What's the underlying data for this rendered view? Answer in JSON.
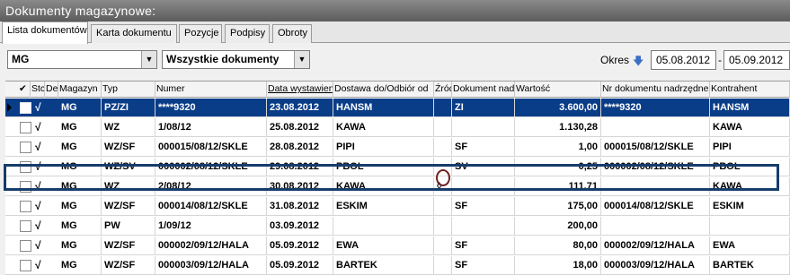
{
  "window": {
    "title": "Dokumenty magazynowe:"
  },
  "tabs": [
    {
      "label": "Lista dokumentów",
      "active": true
    },
    {
      "label": "Karta dokumentu",
      "active": false
    },
    {
      "label": "Pozycje",
      "active": false
    },
    {
      "label": "Podpisy",
      "active": false
    },
    {
      "label": "Obroty",
      "active": false
    }
  ],
  "filters": {
    "magazyn": "MG",
    "dokumenty": "Wszystkie dokumenty",
    "okres_label": "Okres",
    "date_from": "05.08.2012",
    "date_to": "05.09.2012",
    "date_separator": "-"
  },
  "columns": {
    "check": "✔",
    "status": "Stc",
    "de": "De",
    "magazyn": "Magazyn",
    "typ": "Typ",
    "numer": "Numer",
    "data": "Data wystawien",
    "dostawa": "Dostawa do/Odbiór od",
    "zrodlo": "Źródł",
    "dok_nadrz": "Dokument nadrz",
    "wartosc": "Wartość",
    "nr_dok_nadrz": "Nr dokumentu nadrzędne",
    "kontrahent": "Kontrahent"
  },
  "rows": [
    {
      "mark": "√",
      "magazyn": "MG",
      "typ": "PZ/ZI",
      "numer": "****9320",
      "data": "23.08.2012",
      "dostawa": "HANSM",
      "zrodlo": "",
      "dok_nadrz": "ZI",
      "wartosc": "3.600,00",
      "nr_dok_nadrz": "****9320",
      "kontrahent": "HANSM",
      "selected": true
    },
    {
      "mark": "√",
      "magazyn": "MG",
      "typ": "WZ",
      "numer": "1/08/12",
      "data": "25.08.2012",
      "dostawa": "KAWA",
      "zrodlo": "",
      "dok_nadrz": "",
      "wartosc": "1.130,28",
      "nr_dok_nadrz": "",
      "kontrahent": "KAWA",
      "selected": false
    },
    {
      "mark": "√",
      "magazyn": "MG",
      "typ": "WZ/SF",
      "numer": "000015/08/12/SKLE",
      "data": "28.08.2012",
      "dostawa": "PIPI",
      "zrodlo": "",
      "dok_nadrz": "SF",
      "wartosc": "1,00",
      "nr_dok_nadrz": "000015/08/12/SKLE",
      "kontrahent": "PIPI",
      "selected": false
    },
    {
      "mark": "√",
      "magazyn": "MG",
      "typ": "WZ/SV",
      "numer": "000002/08/12/SKLE",
      "data": "29.08.2012",
      "dostawa": "PBOL",
      "zrodlo": "",
      "dok_nadrz": "SV",
      "wartosc": "0,25",
      "nr_dok_nadrz": "000002/08/12/SKLE",
      "kontrahent": "PBOL",
      "selected": false
    },
    {
      "mark": "√",
      "magazyn": "MG",
      "typ": "WZ",
      "numer": "2/08/12",
      "data": "30.08.2012",
      "dostawa": "KAWA",
      "zrodlo": "◊",
      "dok_nadrz": "",
      "wartosc": "111,71",
      "nr_dok_nadrz": "",
      "kontrahent": "KAWA",
      "selected": false
    },
    {
      "mark": "√",
      "magazyn": "MG",
      "typ": "WZ/SF",
      "numer": "000014/08/12/SKLE",
      "data": "31.08.2012",
      "dostawa": "ESKIM",
      "zrodlo": "",
      "dok_nadrz": "SF",
      "wartosc": "175,00",
      "nr_dok_nadrz": "000014/08/12/SKLE",
      "kontrahent": "ESKIM",
      "selected": false
    },
    {
      "mark": "√",
      "magazyn": "MG",
      "typ": "PW",
      "numer": "1/09/12",
      "data": "03.09.2012",
      "dostawa": "",
      "zrodlo": "",
      "dok_nadrz": "",
      "wartosc": "200,00",
      "nr_dok_nadrz": "",
      "kontrahent": "",
      "selected": false
    },
    {
      "mark": "√",
      "magazyn": "MG",
      "typ": "WZ/SF",
      "numer": "000002/09/12/HALA",
      "data": "05.09.2012",
      "dostawa": "EWA",
      "zrodlo": "",
      "dok_nadrz": "SF",
      "wartosc": "80,00",
      "nr_dok_nadrz": "000002/09/12/HALA",
      "kontrahent": "EWA",
      "selected": false
    },
    {
      "mark": "√",
      "magazyn": "MG",
      "typ": "WZ/SF",
      "numer": "000003/09/12/HALA",
      "data": "05.09.2012",
      "dostawa": "BARTEK",
      "zrodlo": "",
      "dok_nadrz": "SF",
      "wartosc": "18,00",
      "nr_dok_nadrz": "000003/09/12/HALA",
      "kontrahent": "BARTEK",
      "selected": false
    }
  ]
}
